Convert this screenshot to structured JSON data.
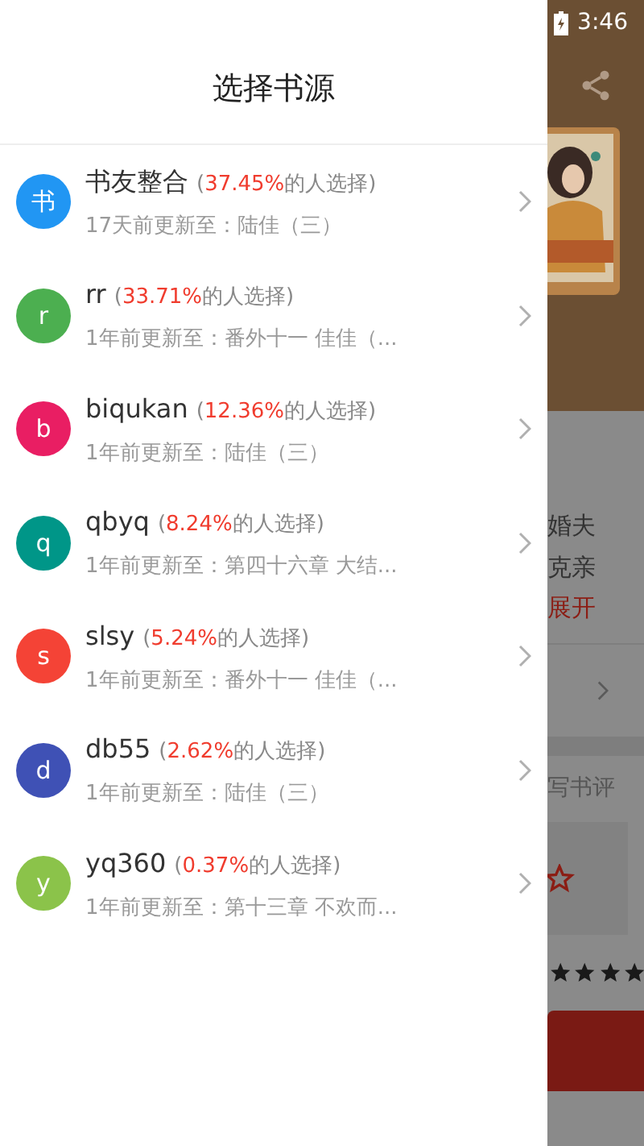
{
  "status_bar": {
    "time": "3:46"
  },
  "drawer": {
    "title": "选择书源",
    "sources": [
      {
        "avatar": "书",
        "name": "书友整合",
        "share_prefix": "(",
        "share": "37.45%",
        "share_suffix": "的人选择)",
        "update": "17天前更新至：陆佳（三）",
        "color": "#2196f3"
      },
      {
        "avatar": "r",
        "name": "rr",
        "share_prefix": "(",
        "share": "33.71%",
        "share_suffix": "的人选择)",
        "update": "1年前更新至：番外十一 佳佳（...",
        "color": "#4caf50"
      },
      {
        "avatar": "b",
        "name": "biqukan",
        "share_prefix": "(",
        "share": "12.36%",
        "share_suffix": "的人选择)",
        "update": "1年前更新至：陆佳（三）",
        "color": "#e91e63"
      },
      {
        "avatar": "q",
        "name": "qbyq",
        "share_prefix": "(",
        "share": "8.24%",
        "share_suffix": "的人选择)",
        "update": "1年前更新至：第四十六章 大结...",
        "color": "#009688"
      },
      {
        "avatar": "s",
        "name": "slsy",
        "share_prefix": "(",
        "share": "5.24%",
        "share_suffix": "的人选择)",
        "update": "1年前更新至：番外十一 佳佳（...",
        "color": "#f44336"
      },
      {
        "avatar": "d",
        "name": "db55",
        "share_prefix": "(",
        "share": "2.62%",
        "share_suffix": "的人选择)",
        "update": "1年前更新至：陆佳（三）",
        "color": "#3f51b5"
      },
      {
        "avatar": "y",
        "name": "yq360",
        "share_prefix": "(",
        "share": "0.37%",
        "share_suffix": "的人选择)",
        "update": "1年前更新至：第十三章 不欢而...",
        "color": "#8bc34a"
      }
    ]
  },
  "background_page": {
    "intro_lines": [
      "婚夫",
      "克亲"
    ],
    "expand_link": "展开",
    "review_label": "写书评",
    "stars": 4
  }
}
